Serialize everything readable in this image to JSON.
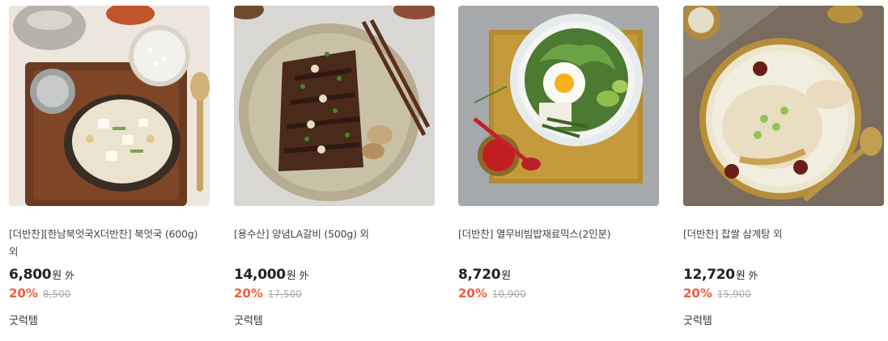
{
  "products": [
    {
      "title": "[더반찬][한남북엇국X더반찬] 북엇국 (600g) 외",
      "price": "6,800",
      "currency": "원",
      "extra": "外",
      "discount": "20%",
      "original_price": "8,500",
      "tag": "굿럭템",
      "image": "bukeo-guk-soup-photo"
    },
    {
      "title": "[용수산] 양념LA갈비 (500g) 외",
      "price": "14,000",
      "currency": "원",
      "extra": "外",
      "discount": "20%",
      "original_price": "17,500",
      "tag": "굿럭템",
      "image": "la-galbi-photo"
    },
    {
      "title": "[더반찬] 열무비빔밥재료믹스(2인분)",
      "price": "8,720",
      "currency": "원",
      "extra": "",
      "discount": "20%",
      "original_price": "10,900",
      "tag": "",
      "image": "bibimbap-photo"
    },
    {
      "title": "[더반찬] 찹쌀 삼계탕 외",
      "price": "12,720",
      "currency": "원",
      "extra": "外",
      "discount": "20%",
      "original_price": "15,900",
      "tag": "굿럭템",
      "image": "samgyetang-photo"
    }
  ],
  "colors": {
    "discount": "#f25c3b",
    "price": "#222222",
    "original": "#aaaaaa"
  }
}
